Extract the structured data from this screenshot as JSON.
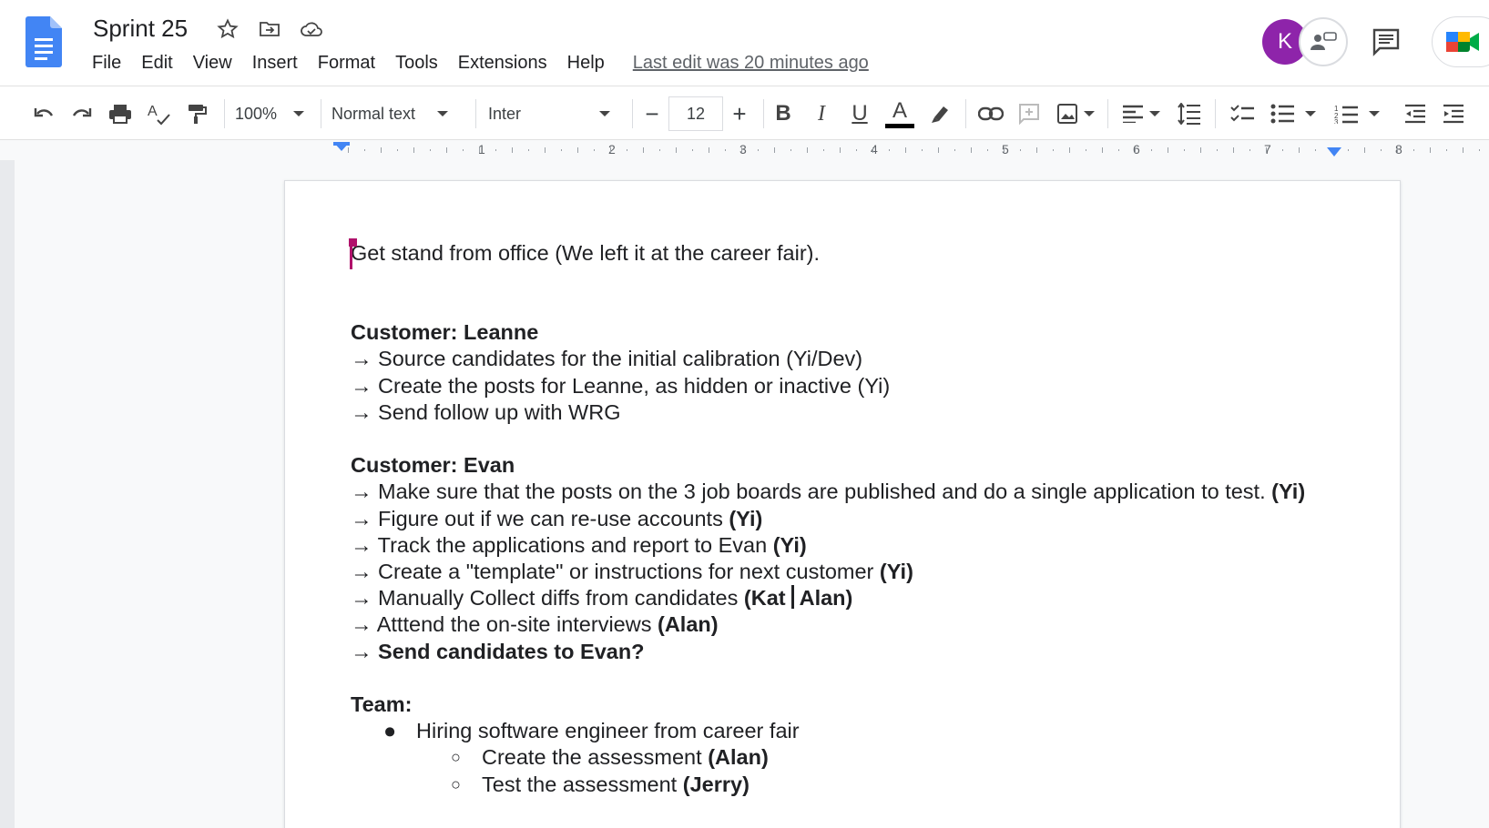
{
  "app": {
    "title": "Sprint 25",
    "last_edit": "Last edit was 20 minutes ago",
    "avatar_letter": "K",
    "accent": "#4285f4",
    "avatar_color": "#8e24aa",
    "cursor_color": "#b0126b"
  },
  "menu": [
    "File",
    "Edit",
    "View",
    "Insert",
    "Format",
    "Tools",
    "Extensions",
    "Help"
  ],
  "toolbar": {
    "zoom": "100%",
    "style": "Normal text",
    "font": "Inter",
    "font_size": "12",
    "minus": "−",
    "plus": "+",
    "bold": "B",
    "italic": "I",
    "underline": "U",
    "text_color": "A"
  },
  "ruler": [
    "1",
    "2",
    "3",
    "4",
    "5",
    "6",
    "7",
    "8"
  ],
  "doc": {
    "line1": "Get stand from office (We left it at the career fair).",
    "leanne_heading": "Customer: Leanne",
    "leanne_items": [
      "→ Source candidates for the initial calibration (Yi/Dev)",
      "→ Create the posts for Leanne, as hidden or inactive (Yi)",
      "→ Send follow up with WRG"
    ],
    "evan_heading": "Customer: Evan",
    "evan_items": [
      {
        "text": "→ Make sure that the posts on the 3 job boards are published and do a single application to test. ",
        "bold": "(Yi)"
      },
      {
        "text": "→ Figure out if we can re-use accounts ",
        "bold": "(Yi)"
      },
      {
        "text": "→ Track the applications and report to Evan ",
        "bold": "(Yi)"
      },
      {
        "text": "→ Create a \"template\" or instructions for next customer ",
        "bold": "(Yi)"
      }
    ],
    "evan_collect_arrow": "→",
    "evan_collect_text": " Manually Collect diffs from candidates ",
    "evan_collect_bold_a": "(Kat",
    "evan_collect_bold_b": "Alan)",
    "evan_attend_text": "→ Atttend the on-site interviews ",
    "evan_attend_bold": "(Alan)",
    "evan_send": "→ Send candidates to Evan?",
    "team_heading": "Team:",
    "team_bullet": "Hiring software engineer from career fair",
    "team_sub": [
      {
        "text": "Create the assessment ",
        "bold": "(Alan)"
      },
      {
        "text": "Test the assessment ",
        "bold": "(Jerry)"
      }
    ],
    "bullet_marker": "●",
    "sub_marker": "○"
  }
}
